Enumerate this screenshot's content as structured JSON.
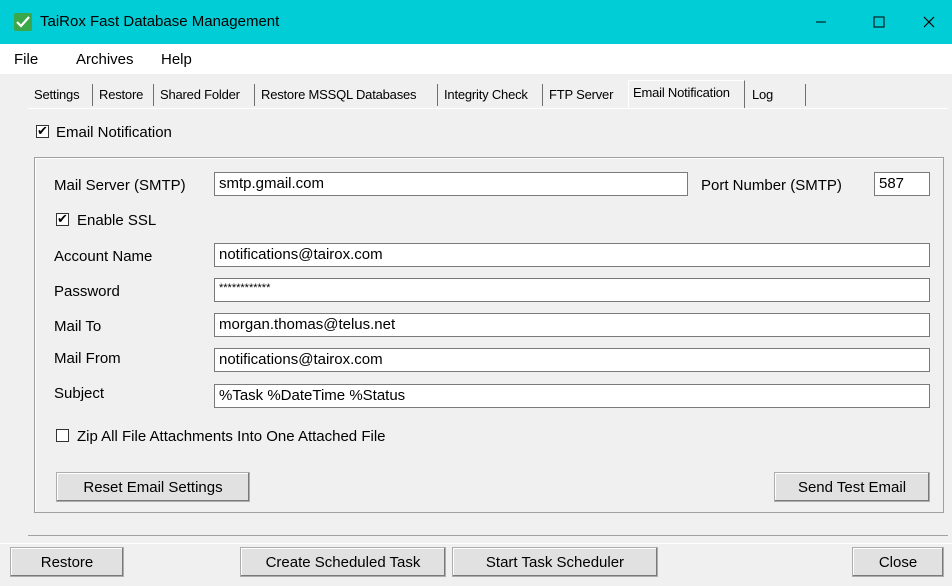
{
  "window": {
    "title": "TaiRox Fast Database Management",
    "accent_color": "#00cdd6"
  },
  "menu": {
    "items": [
      "File",
      "Archives",
      "Help"
    ]
  },
  "tabs": [
    {
      "label": "Settings"
    },
    {
      "label": "Restore"
    },
    {
      "label": "Shared Folder"
    },
    {
      "label": "Restore MSSQL Databases"
    },
    {
      "label": "Integrity Check"
    },
    {
      "label": "FTP Server"
    },
    {
      "label": "Email Notification",
      "active": true
    },
    {
      "label": "Log"
    }
  ],
  "email": {
    "enabled_label": "Email Notification",
    "enabled": true,
    "mail_server_label": "Mail Server (SMTP)",
    "mail_server_value": "smtp.gmail.com",
    "port_label": "Port Number (SMTP)",
    "port_value": "587",
    "ssl_label": "Enable SSL",
    "ssl_enabled": true,
    "account_label": "Account Name",
    "account_value": "notifications@tairox.com",
    "password_label": "Password",
    "password_value": "************",
    "mail_to_label": "Mail To",
    "mail_to_value": "morgan.thomas@telus.net",
    "mail_from_label": "Mail From",
    "mail_from_value": "notifications@tairox.com",
    "subject_label": "Subject",
    "subject_value": "%Task %DateTime %Status",
    "zip_label": "Zip All File Attachments Into One Attached File",
    "zip_enabled": false,
    "reset_button": "Reset Email Settings",
    "test_button": "Send Test Email"
  },
  "footer": {
    "restore_button": "Restore",
    "create_task_button": "Create Scheduled Task",
    "start_scheduler_button": "Start Task Scheduler",
    "close_button": "Close"
  }
}
